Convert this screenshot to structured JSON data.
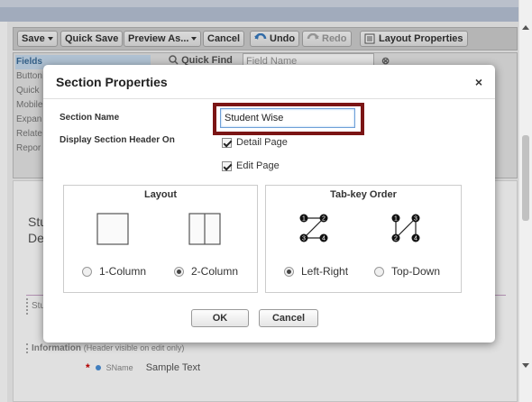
{
  "toolbar": {
    "save": "Save",
    "quick_save": "Quick Save",
    "preview_as": "Preview As...",
    "cancel": "Cancel",
    "undo": "Undo",
    "redo": "Redo",
    "layout_properties": "Layout Properties"
  },
  "palette": {
    "items": [
      "Fields",
      "Button",
      "Quick",
      "Mobile",
      "Expan",
      "Relate",
      "Repor"
    ],
    "quick_find_label": "Quick Find",
    "quick_find_placeholder": "Field Name"
  },
  "canvas": {
    "title_line1": "Stu",
    "title_line2": "Det",
    "section_box": "Stu",
    "info_label": "Information",
    "info_sub": "(Header visible on edit only)",
    "field_name": "SName",
    "field_value": "Sample Text"
  },
  "modal": {
    "title": "Section Properties",
    "close": "×",
    "section_name_label": "Section Name",
    "section_name_value": "Student Wise",
    "display_header_label": "Display Section Header On",
    "detail_page": "Detail Page",
    "edit_page": "Edit Page",
    "layout": {
      "title": "Layout",
      "one_col": "1-Column",
      "two_col": "2-Column",
      "selected": "2-Column"
    },
    "tabkey": {
      "title": "Tab-key Order",
      "left_right": "Left-Right",
      "top_down": "Top-Down",
      "selected": "Left-Right"
    },
    "ok": "OK",
    "cancel": "Cancel"
  },
  "colors": {
    "highlight": "#7b1515",
    "input_border": "#6fa0d8"
  }
}
